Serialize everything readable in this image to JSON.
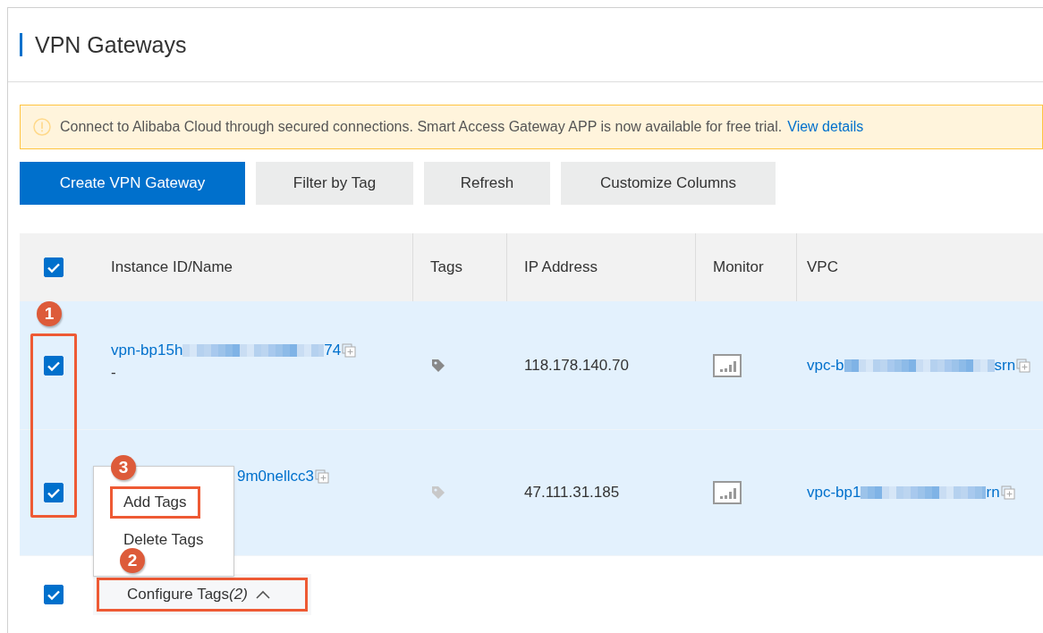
{
  "page": {
    "title": "VPN Gateways"
  },
  "notice": {
    "text": "Connect to Alibaba Cloud through secured connections. Smart Access Gateway APP is now available for free trial.",
    "link": "View details"
  },
  "toolbar": [
    {
      "label": "Create VPN Gateway",
      "kind": "primary"
    },
    {
      "label": "Filter by Tag",
      "kind": "default"
    },
    {
      "label": "Refresh",
      "kind": "default"
    },
    {
      "label": "Customize Columns",
      "kind": "default"
    }
  ],
  "table": {
    "header_checked": true,
    "checkbox_outlined": true,
    "columns": [
      "Instance ID/Name",
      "Tags",
      "IP Address",
      "Monitor",
      "VPC"
    ],
    "rows": [
      {
        "checked": true,
        "instance_start": "vpn-bp15h",
        "instance_end": "74",
        "name": "-",
        "has_tags": true,
        "ip": "118.178.140.70",
        "vpc_start": "vpc-b",
        "vpc_end": "srn"
      },
      {
        "checked": true,
        "instance_end": "9m0nellcc3",
        "has_tags": false,
        "ip": "47.111.31.185",
        "vpc_start": "vpc-bp1",
        "vpc_end": "rn"
      }
    ]
  },
  "footer": {
    "checked": true,
    "button": "Configure Tags",
    "count": "(2)",
    "expanded": true,
    "outlined": true
  },
  "menu": {
    "items": [
      {
        "label": "Add Tags",
        "outlined": true
      },
      {
        "label": "Delete Tags",
        "outlined": false
      }
    ]
  },
  "annotations": [
    {
      "number": "1"
    },
    {
      "number": "3"
    },
    {
      "number": "2"
    }
  ]
}
